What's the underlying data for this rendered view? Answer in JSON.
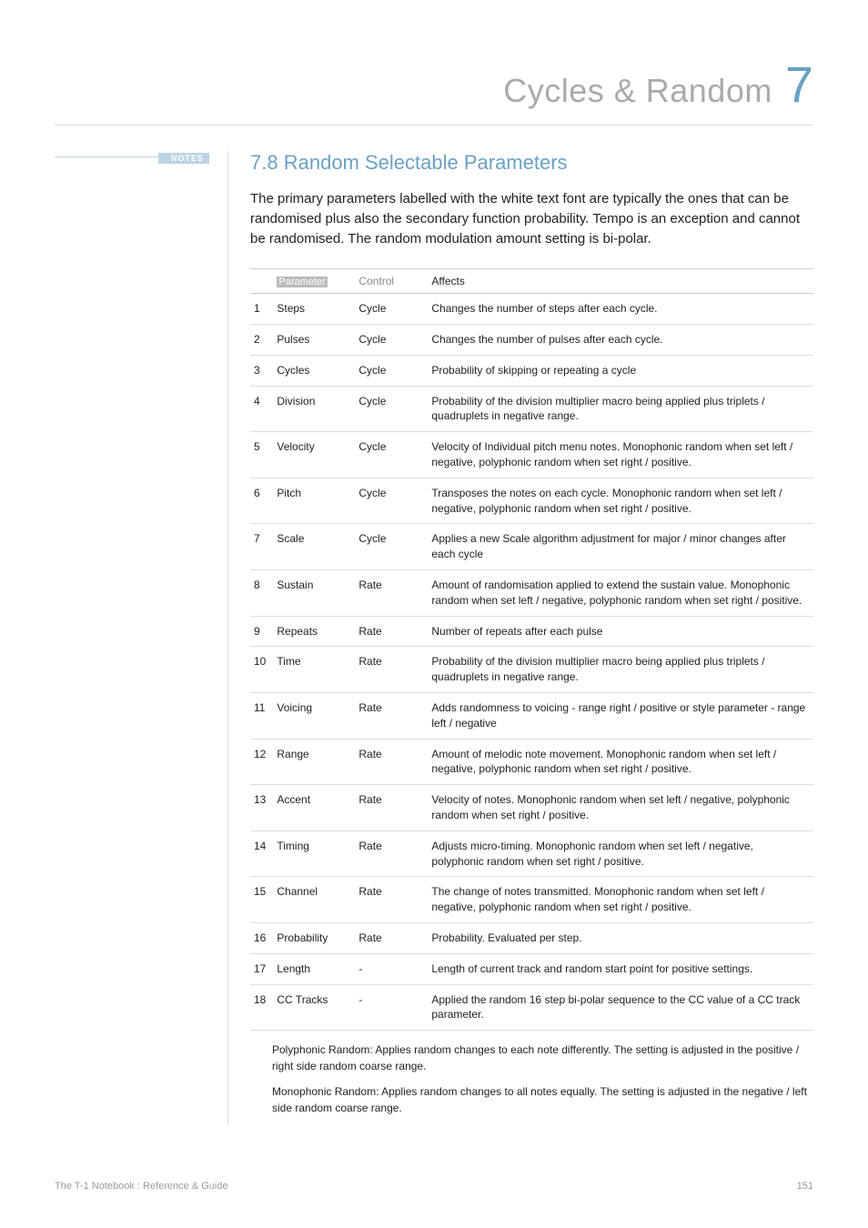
{
  "header": {
    "title": "Cycles & Random",
    "chapter_number": "7"
  },
  "notes_label": "NOTES",
  "section": {
    "heading_prefix": "7.8",
    "heading": "Random Selectable Parameters",
    "intro": "The primary parameters labelled with the white text font are typically the ones that can be randomised plus also the secondary function probability. Tempo is an exception and cannot be randomised. The random modulation amount setting is bi-polar."
  },
  "table": {
    "headers": {
      "num": "",
      "parameter": "Parameter",
      "control": "Control",
      "affects": "Affects"
    },
    "rows": [
      {
        "n": "1",
        "param": "Steps",
        "ctrl": "Cycle",
        "affects": "Changes the number of steps after each cycle."
      },
      {
        "n": "2",
        "param": "Pulses",
        "ctrl": "Cycle",
        "affects": "Changes the number of pulses after each cycle."
      },
      {
        "n": "3",
        "param": "Cycles",
        "ctrl": "Cycle",
        "affects": "Probability of skipping or repeating a cycle"
      },
      {
        "n": "4",
        "param": "Division",
        "ctrl": "Cycle",
        "affects": "Probability of the division multiplier macro being applied plus triplets / quadruplets in negative range."
      },
      {
        "n": "5",
        "param": "Velocity",
        "ctrl": "Cycle",
        "affects": "Velocity of Individual pitch menu notes. Monophonic random when set left / negative, polyphonic random when set right / positive."
      },
      {
        "n": "6",
        "param": "Pitch",
        "ctrl": "Cycle",
        "affects": "Transposes the notes on each cycle. Monophonic random when set left / negative, polyphonic random when set right / positive."
      },
      {
        "n": "7",
        "param": "Scale",
        "ctrl": "Cycle",
        "affects": "Applies a new Scale algorithm adjustment for major / minor changes after each cycle"
      },
      {
        "n": "8",
        "param": "Sustain",
        "ctrl": "Rate",
        "affects": "Amount of randomisation applied to extend the sustain value. Monophonic random when set left / negative, polyphonic random when set right / positive."
      },
      {
        "n": "9",
        "param": "Repeats",
        "ctrl": "Rate",
        "affects": "Number of repeats after each pulse"
      },
      {
        "n": "10",
        "param": "Time",
        "ctrl": "Rate",
        "affects": "Probability of the division multiplier macro being applied plus triplets / quadruplets in negative range."
      },
      {
        "n": "11",
        "param": "Voicing",
        "ctrl": "Rate",
        "affects": "Adds randomness to voicing - range right / positive or style parameter - range left / negative"
      },
      {
        "n": "12",
        "param": "Range",
        "ctrl": "Rate",
        "affects": "Amount of melodic note movement. Monophonic random when set left / negative, polyphonic random when set right / positive."
      },
      {
        "n": "13",
        "param": "Accent",
        "ctrl": "Rate",
        "affects": "Velocity of notes. Monophonic random when set left / negative, polyphonic random when set right / positive."
      },
      {
        "n": "14",
        "param": "Timing",
        "ctrl": "Rate",
        "affects": "Adjusts micro-timing. Monophonic random when set left / negative, polyphonic random when set right / positive."
      },
      {
        "n": "15",
        "param": "Channel",
        "ctrl": "Rate",
        "affects": "The change of notes transmitted. Monophonic random when set left / negative, polyphonic random when set right / positive."
      },
      {
        "n": "16",
        "param": "Probability",
        "ctrl": "Rate",
        "affects": "Probability. Evaluated per step."
      },
      {
        "n": "17",
        "param": "Length",
        "ctrl": "-",
        "affects": "Length of current track and random start point for positive settings."
      },
      {
        "n": "18",
        "param": "CC Tracks",
        "ctrl": "-",
        "affects": "Applied the random 16 step bi-polar sequence to the CC value of a CC track parameter."
      }
    ]
  },
  "legend": {
    "poly": "Polyphonic Random: Applies random changes to each note differently. The setting is adjusted in the positive / right side random coarse range.",
    "mono": "Monophonic Random: Applies random changes to all notes equally. The setting is adjusted in the negative / left side random coarse range."
  },
  "footer": {
    "left": "The T-1 Notebook : Reference & Guide",
    "right": "151"
  }
}
